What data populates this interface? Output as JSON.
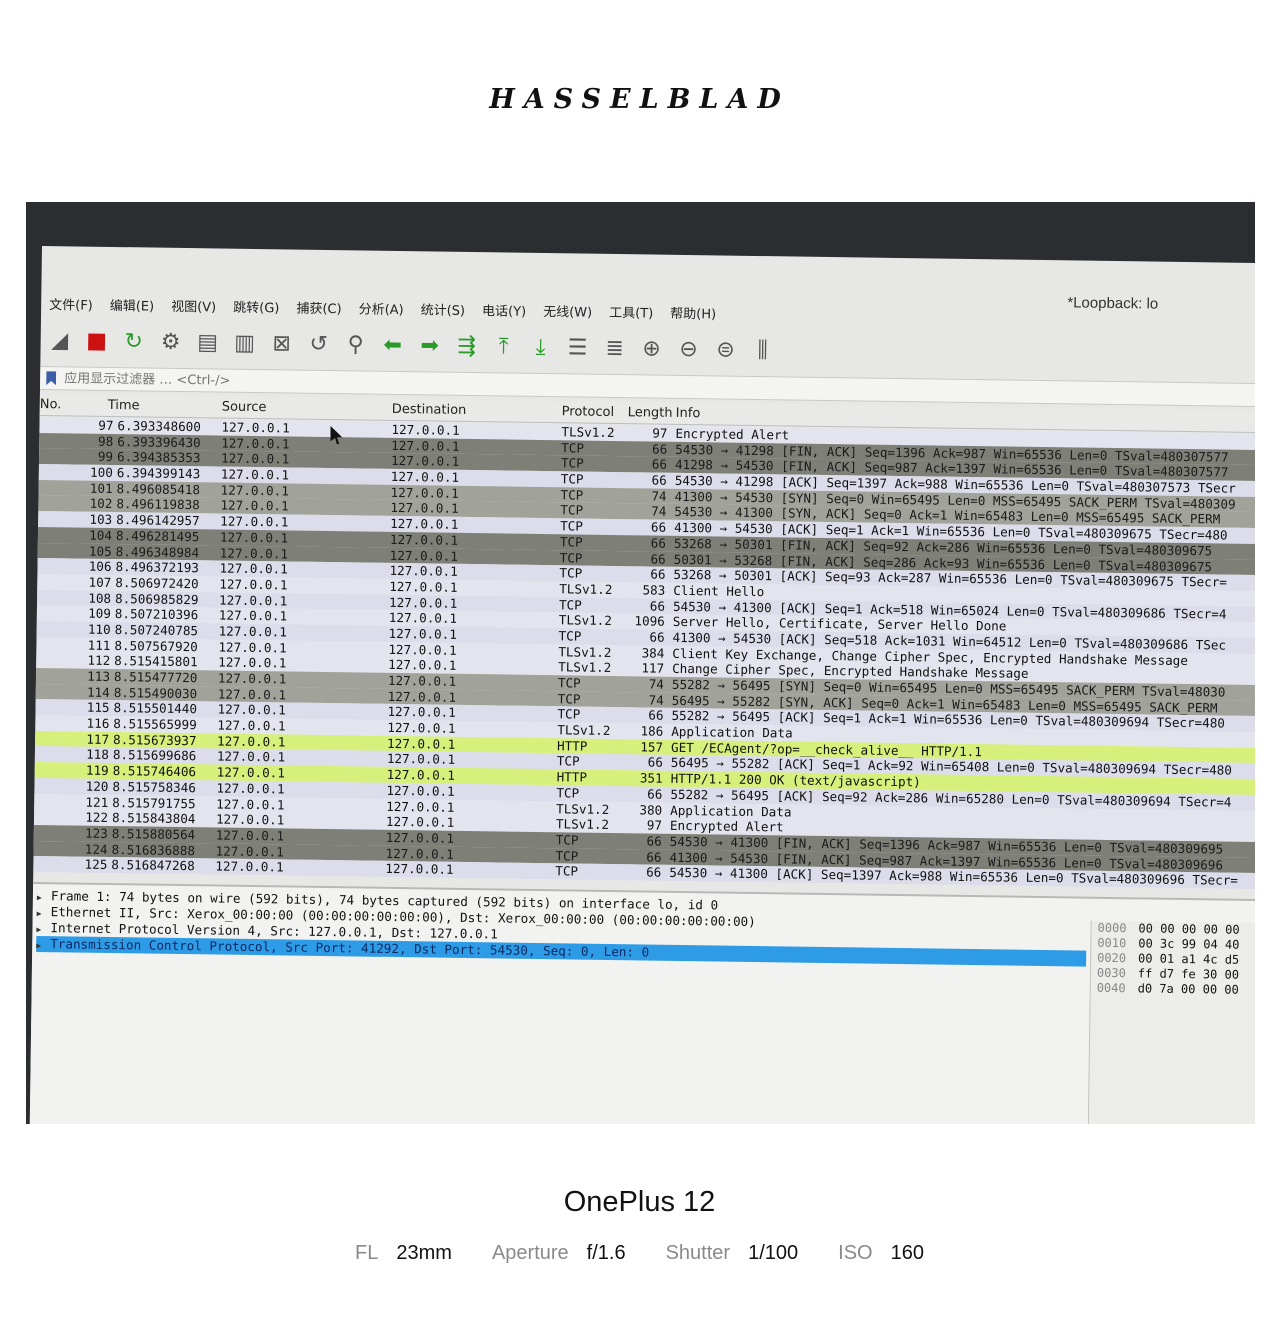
{
  "brand": "HASSELBLAD",
  "camera": {
    "device": "OnePlus 12",
    "specs": [
      {
        "label": "FL",
        "value": "23mm"
      },
      {
        "label": "Aperture",
        "value": "f/1.6"
      },
      {
        "label": "Shutter",
        "value": "1/100"
      },
      {
        "label": "ISO",
        "value": "160"
      }
    ]
  },
  "wireshark": {
    "window_title": "*Loopback: lo",
    "menu": [
      "文件(F)",
      "编辑(E)",
      "视图(V)",
      "跳转(G)",
      "捕获(C)",
      "分析(A)",
      "统计(S)",
      "电话(Y)",
      "无线(W)",
      "工具(T)",
      "帮助(H)"
    ],
    "toolbar": [
      {
        "icon": "shark-fin-start-icon",
        "glyph": "◢",
        "cls": ""
      },
      {
        "icon": "stop-capture-icon",
        "glyph": "■",
        "cls": "red"
      },
      {
        "icon": "restart-capture-icon",
        "glyph": "↻",
        "cls": "green"
      },
      {
        "icon": "capture-options-icon",
        "glyph": "⚙",
        "cls": ""
      },
      {
        "icon": "open-file-icon",
        "glyph": "▤",
        "cls": ""
      },
      {
        "icon": "save-file-icon",
        "glyph": "▥",
        "cls": ""
      },
      {
        "icon": "close-file-icon",
        "glyph": "⊠",
        "cls": ""
      },
      {
        "icon": "reload-file-icon",
        "glyph": "↺",
        "cls": ""
      },
      {
        "icon": "find-packet-icon",
        "glyph": "⚲",
        "cls": ""
      },
      {
        "icon": "go-back-icon",
        "glyph": "⬅",
        "cls": "green"
      },
      {
        "icon": "go-forward-icon",
        "glyph": "➡",
        "cls": "green"
      },
      {
        "icon": "go-to-packet-icon",
        "glyph": "⇶",
        "cls": "green"
      },
      {
        "icon": "go-first-packet-icon",
        "glyph": "⤒",
        "cls": "green"
      },
      {
        "icon": "go-last-packet-icon",
        "glyph": "⤓",
        "cls": "green"
      },
      {
        "icon": "autoscroll-icon",
        "glyph": "☰",
        "cls": ""
      },
      {
        "icon": "colorize-icon",
        "glyph": "≣",
        "cls": ""
      },
      {
        "icon": "zoom-in-icon",
        "glyph": "⊕",
        "cls": ""
      },
      {
        "icon": "zoom-out-icon",
        "glyph": "⊖",
        "cls": ""
      },
      {
        "icon": "zoom-reset-icon",
        "glyph": "⊜",
        "cls": ""
      },
      {
        "icon": "resize-columns-icon",
        "glyph": "⫼",
        "cls": ""
      }
    ],
    "filter_placeholder": "应用显示过滤器 … <Ctrl-/>",
    "columns": {
      "no": "No.",
      "time": "Time",
      "source": "Source",
      "destination": "Destination",
      "protocol": "Protocol",
      "length": "Length",
      "info": "Info"
    },
    "packets": [
      {
        "no": "97",
        "time": "6.393348600",
        "src": "127.0.0.1",
        "dst": "127.0.0.1",
        "proto": "TLSv1.2",
        "len": "97",
        "info": "Encrypted Alert",
        "kind": "tls"
      },
      {
        "no": "98",
        "time": "6.393396430",
        "src": "127.0.0.1",
        "dst": "127.0.0.1",
        "proto": "TCP",
        "len": "66",
        "info": "54530 → 41298 [FIN, ACK] Seq=1396 Ack=987 Win=65536 Len=0 TSval=480307577",
        "kind": "fin"
      },
      {
        "no": "99",
        "time": "6.394385353",
        "src": "127.0.0.1",
        "dst": "127.0.0.1",
        "proto": "TCP",
        "len": "66",
        "info": "41298 → 54530 [FIN, ACK] Seq=987 Ack=1397 Win=65536 Len=0 TSval=480307577",
        "kind": "fin"
      },
      {
        "no": "100",
        "time": "6.394399143",
        "src": "127.0.0.1",
        "dst": "127.0.0.1",
        "proto": "TCP",
        "len": "66",
        "info": "54530 → 41298 [ACK] Seq=1397 Ack=988 Win=65536 Len=0 TSval=480307573 TSecr",
        "kind": "ack"
      },
      {
        "no": "101",
        "time": "8.496085418",
        "src": "127.0.0.1",
        "dst": "127.0.0.1",
        "proto": "TCP",
        "len": "74",
        "info": "41300 → 54530 [SYN] Seq=0 Win=65495 Len=0 MSS=65495 SACK_PERM TSval=480309",
        "kind": "syn"
      },
      {
        "no": "102",
        "time": "8.496119838",
        "src": "127.0.0.1",
        "dst": "127.0.0.1",
        "proto": "TCP",
        "len": "74",
        "info": "54530 → 41300 [SYN, ACK] Seq=0 Ack=1 Win=65483 Len=0 MSS=65495 SACK_PERM",
        "kind": "syn"
      },
      {
        "no": "103",
        "time": "8.496142957",
        "src": "127.0.0.1",
        "dst": "127.0.0.1",
        "proto": "TCP",
        "len": "66",
        "info": "41300 → 54530 [ACK] Seq=1 Ack=1 Win=65536 Len=0 TSval=480309675 TSecr=480",
        "kind": "ack"
      },
      {
        "no": "104",
        "time": "8.496281495",
        "src": "127.0.0.1",
        "dst": "127.0.0.1",
        "proto": "TCP",
        "len": "66",
        "info": "53268 → 50301 [FIN, ACK] Seq=92 Ack=286 Win=65536 Len=0 TSval=480309675",
        "kind": "fin"
      },
      {
        "no": "105",
        "time": "8.496348984",
        "src": "127.0.0.1",
        "dst": "127.0.0.1",
        "proto": "TCP",
        "len": "66",
        "info": "50301 → 53268 [FIN, ACK] Seq=286 Ack=93 Win=65536 Len=0 TSval=480309675",
        "kind": "fin"
      },
      {
        "no": "106",
        "time": "8.496372193",
        "src": "127.0.0.1",
        "dst": "127.0.0.1",
        "proto": "TCP",
        "len": "66",
        "info": "53268 → 50301 [ACK] Seq=93 Ack=287 Win=65536 Len=0 TSval=480309675 TSecr=",
        "kind": "ack"
      },
      {
        "no": "107",
        "time": "8.506972420",
        "src": "127.0.0.1",
        "dst": "127.0.0.1",
        "proto": "TLSv1.2",
        "len": "583",
        "info": "Client Hello",
        "kind": "tls"
      },
      {
        "no": "108",
        "time": "8.506985829",
        "src": "127.0.0.1",
        "dst": "127.0.0.1",
        "proto": "TCP",
        "len": "66",
        "info": "54530 → 41300 [ACK] Seq=1 Ack=518 Win=65024 Len=0 TSval=480309686 TSecr=4",
        "kind": "ack"
      },
      {
        "no": "109",
        "time": "8.507210396",
        "src": "127.0.0.1",
        "dst": "127.0.0.1",
        "proto": "TLSv1.2",
        "len": "1096",
        "info": "Server Hello, Certificate, Server Hello Done",
        "kind": "tls"
      },
      {
        "no": "110",
        "time": "8.507240785",
        "src": "127.0.0.1",
        "dst": "127.0.0.1",
        "proto": "TCP",
        "len": "66",
        "info": "41300 → 54530 [ACK] Seq=518 Ack=1031 Win=64512 Len=0 TSval=480309686 TSec",
        "kind": "ack"
      },
      {
        "no": "111",
        "time": "8.507567920",
        "src": "127.0.0.1",
        "dst": "127.0.0.1",
        "proto": "TLSv1.2",
        "len": "384",
        "info": "Client Key Exchange, Change Cipher Spec, Encrypted Handshake Message",
        "kind": "tls"
      },
      {
        "no": "112",
        "time": "8.515415801",
        "src": "127.0.0.1",
        "dst": "127.0.0.1",
        "proto": "TLSv1.2",
        "len": "117",
        "info": "Change Cipher Spec, Encrypted Handshake Message",
        "kind": "tls"
      },
      {
        "no": "113",
        "time": "8.515477720",
        "src": "127.0.0.1",
        "dst": "127.0.0.1",
        "proto": "TCP",
        "len": "74",
        "info": "55282 → 56495 [SYN] Seq=0 Win=65495 Len=0 MSS=65495 SACK_PERM TSval=48030",
        "kind": "syn"
      },
      {
        "no": "114",
        "time": "8.515490030",
        "src": "127.0.0.1",
        "dst": "127.0.0.1",
        "proto": "TCP",
        "len": "74",
        "info": "56495 → 55282 [SYN, ACK] Seq=0 Ack=1 Win=65483 Len=0 MSS=65495 SACK_PERM",
        "kind": "syn"
      },
      {
        "no": "115",
        "time": "8.515501440",
        "src": "127.0.0.1",
        "dst": "127.0.0.1",
        "proto": "TCP",
        "len": "66",
        "info": "55282 → 56495 [ACK] Seq=1 Ack=1 Win=65536 Len=0 TSval=480309694 TSecr=480",
        "kind": "ack"
      },
      {
        "no": "116",
        "time": "8.515565999",
        "src": "127.0.0.1",
        "dst": "127.0.0.1",
        "proto": "TLSv1.2",
        "len": "186",
        "info": "Application Data",
        "kind": "tls"
      },
      {
        "no": "117",
        "time": "8.515673937",
        "src": "127.0.0.1",
        "dst": "127.0.0.1",
        "proto": "HTTP",
        "len": "157",
        "info": "GET /ECAgent/?op=__check_alive__ HTTP/1.1",
        "kind": "http"
      },
      {
        "no": "118",
        "time": "8.515699686",
        "src": "127.0.0.1",
        "dst": "127.0.0.1",
        "proto": "TCP",
        "len": "66",
        "info": "56495 → 55282 [ACK] Seq=1 Ack=92 Win=65408 Len=0 TSval=480309694 TSecr=480",
        "kind": "ack"
      },
      {
        "no": "119",
        "time": "8.515746406",
        "src": "127.0.0.1",
        "dst": "127.0.0.1",
        "proto": "HTTP",
        "len": "351",
        "info": "HTTP/1.1 200 OK  (text/javascript)",
        "kind": "http"
      },
      {
        "no": "120",
        "time": "8.515758346",
        "src": "127.0.0.1",
        "dst": "127.0.0.1",
        "proto": "TCP",
        "len": "66",
        "info": "55282 → 56495 [ACK] Seq=92 Ack=286 Win=65280 Len=0 TSval=480309694 TSecr=4",
        "kind": "ack"
      },
      {
        "no": "121",
        "time": "8.515791755",
        "src": "127.0.0.1",
        "dst": "127.0.0.1",
        "proto": "TLSv1.2",
        "len": "380",
        "info": "Application Data",
        "kind": "tls"
      },
      {
        "no": "122",
        "time": "8.515843804",
        "src": "127.0.0.1",
        "dst": "127.0.0.1",
        "proto": "TLSv1.2",
        "len": "97",
        "info": "Encrypted Alert",
        "kind": "tls"
      },
      {
        "no": "123",
        "time": "8.515880564",
        "src": "127.0.0.1",
        "dst": "127.0.0.1",
        "proto": "TCP",
        "len": "66",
        "info": "54530 → 41300 [FIN, ACK] Seq=1396 Ack=987 Win=65536 Len=0 TSval=480309695",
        "kind": "fin"
      },
      {
        "no": "124",
        "time": "8.516836888",
        "src": "127.0.0.1",
        "dst": "127.0.0.1",
        "proto": "TCP",
        "len": "66",
        "info": "41300 → 54530 [FIN, ACK] Seq=987 Ack=1397 Win=65536 Len=0 TSval=480309696",
        "kind": "fin"
      },
      {
        "no": "125",
        "time": "8.516847268",
        "src": "127.0.0.1",
        "dst": "127.0.0.1",
        "proto": "TCP",
        "len": "66",
        "info": "54530 → 41300 [ACK] Seq=1397 Ack=988 Win=65536 Len=0 TSval=480309696 TSecr=",
        "kind": "ack"
      }
    ],
    "details": [
      {
        "text": "Frame 1: 74 bytes on wire (592 bits), 74 bytes captured (592 bits) on interface lo, id 0",
        "selected": false
      },
      {
        "text": "Ethernet II, Src: Xerox_00:00:00 (00:00:00:00:00:00), Dst: Xerox_00:00:00 (00:00:00:00:00:00)",
        "selected": false
      },
      {
        "text": "Internet Protocol Version 4, Src: 127.0.0.1, Dst: 127.0.0.1",
        "selected": false
      },
      {
        "text": "Transmission Control Protocol, Src Port: 41292, Dst Port: 54530, Seq: 0, Len: 0",
        "selected": true
      }
    ],
    "hex": [
      {
        "offset": "0000",
        "bytes": "00 00 00 00 00"
      },
      {
        "offset": "0010",
        "bytes": "00 3c 99 04 40"
      },
      {
        "offset": "0020",
        "bytes": "00 01 a1 4c d5"
      },
      {
        "offset": "0030",
        "bytes": "ff d7 fe 30 00"
      },
      {
        "offset": "0040",
        "bytes": "d0 7a 00 00 00"
      }
    ]
  }
}
